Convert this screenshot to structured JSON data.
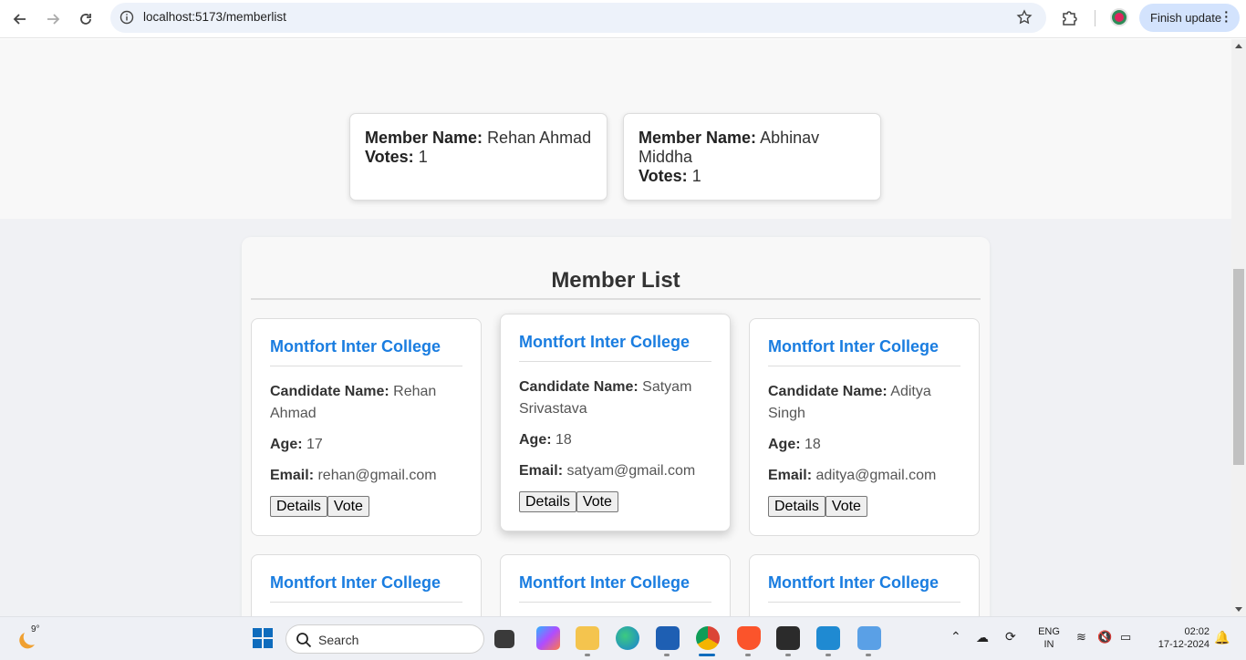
{
  "browser": {
    "url": "localhost:5173/memberlist",
    "finish_update_label": "Finish update"
  },
  "results": [
    {
      "label": "Member Name:",
      "name": "Rehan Ahmad",
      "votes_label": "Votes:",
      "votes": "1"
    },
    {
      "label": "Member Name:",
      "name": "Abhinav Middha",
      "votes_label": "Votes:",
      "votes": "1"
    }
  ],
  "member_list": {
    "title": "Member List",
    "cards": [
      {
        "college": "Montfort Inter College",
        "candidate_label": "Candidate Name:",
        "candidate": "Rehan Ahmad",
        "age_label": "Age:",
        "age": "17",
        "email_label": "Email:",
        "email": "rehan@gmail.com",
        "details": "Details",
        "vote": "Vote"
      },
      {
        "college": "Montfort Inter College",
        "candidate_label": "Candidate Name:",
        "candidate": "Satyam Srivastava",
        "age_label": "Age:",
        "age": "18",
        "email_label": "Email:",
        "email": "satyam@gmail.com",
        "details": "Details",
        "vote": "Vote"
      },
      {
        "college": "Montfort Inter College",
        "candidate_label": "Candidate Name:",
        "candidate": "Aditya Singh",
        "age_label": "Age:",
        "age": "18",
        "email_label": "Email:",
        "email": "aditya@gmail.com",
        "details": "Details",
        "vote": "Vote"
      },
      {
        "college": "Montfort Inter College"
      },
      {
        "college": "Montfort Inter College"
      },
      {
        "college": "Montfort Inter College"
      }
    ]
  },
  "taskbar": {
    "temperature": "9°",
    "search_placeholder": "Search",
    "language": "ENG",
    "region": "IN",
    "time": "02:02",
    "date": "17-12-2024"
  },
  "colors": {
    "college_link": "#1a7de0",
    "url_bar": "#edf2fa",
    "finish_update_bg": "#d3e3fd"
  }
}
